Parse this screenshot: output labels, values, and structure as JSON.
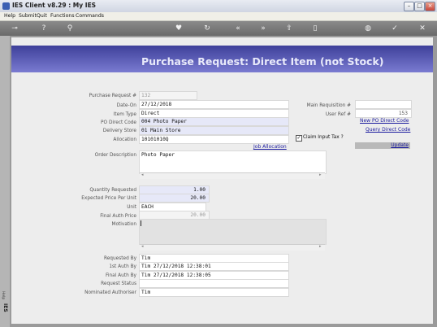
{
  "window": {
    "title": "IES Client v8.29 : My IES"
  },
  "menu": [
    "Help",
    "Submit",
    "Quit",
    "Functions",
    "Commands"
  ],
  "toolbar_icons": [
    "key-icon",
    "help-icon",
    "search-icon",
    "heart-icon",
    "refresh-icon",
    "rewind-icon",
    "forward-icon",
    "upload-icon",
    "page-icon",
    "globe-icon",
    "check-icon",
    "close-icon"
  ],
  "page": {
    "title": "Purchase Request: Direct Item (not Stock)"
  },
  "form": {
    "purchase_request": {
      "label": "Purchase Request #",
      "value": "132"
    },
    "date_on": {
      "label": "Date-On",
      "value": "27/12/2018"
    },
    "item_type": {
      "label": "Item Type",
      "value": "Direct"
    },
    "po_direct_code": {
      "label": "PO Direct Code",
      "value": "004 Photo Paper"
    },
    "delivery_store": {
      "label": "Delivery Store",
      "value": "01 Main Store"
    },
    "allocation": {
      "label": "Allocation",
      "value": "10101010Q"
    },
    "job_allocation_link": "Job Allocation",
    "order_description": {
      "label": "Order Description",
      "value": "Photo Paper"
    },
    "quantity_requested": {
      "label": "Quantity Requested",
      "value": "1.00"
    },
    "expected_price": {
      "label": "Expected Price Per Unit",
      "value": "20.00"
    },
    "unit": {
      "label": "Unit",
      "value": "EACH"
    },
    "final_auth_price": {
      "label": "Final Auth Price",
      "value": "20.00"
    },
    "motivation": {
      "label": "Motivation",
      "value": ""
    },
    "requested_by": {
      "label": "Requested By",
      "value": "Tim"
    },
    "first_auth_by": {
      "label": "1st Auth By",
      "value": "Tim 27/12/2018 12:38:01"
    },
    "final_auth_by": {
      "label": "Final Auth By",
      "value": "Tim 27/12/2018 12:38:05"
    },
    "request_status": {
      "label": "Request Status",
      "value": ""
    },
    "nominated_authoriser": {
      "label": "Nominated Authoriser",
      "value": "Tim"
    }
  },
  "right": {
    "main_requisition": {
      "label": "Main Requisition #",
      "value": ""
    },
    "user_ref": {
      "label": "User Ref #",
      "value": "153"
    },
    "new_po_direct_code": "New PO Direct Code",
    "query_direct_code": "Query Direct Code",
    "claim_input_tax": {
      "label": "Claim Input Tax ?",
      "checked": true
    },
    "update": "Update"
  },
  "left_strip": {
    "tab": "Help",
    "logo": "IES"
  }
}
